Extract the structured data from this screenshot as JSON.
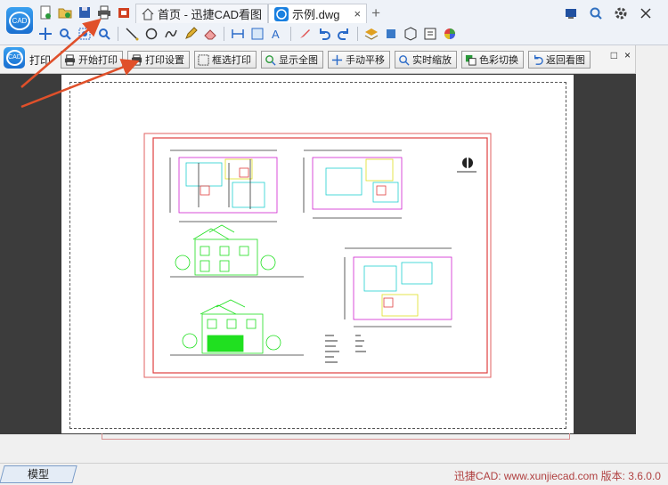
{
  "app": {
    "logo_text": "CAD"
  },
  "tabs": [
    {
      "label": "首页 - 迅捷CAD看图",
      "icon": "home-icon"
    },
    {
      "label": "示例.dwg",
      "icon": "cad-file-icon",
      "close": "×"
    }
  ],
  "new_tab": "+",
  "print_panel": {
    "title": "打印",
    "buttons": [
      {
        "label": "开始打印",
        "icon": "printer-icon"
      },
      {
        "label": "打印设置",
        "icon": "print-settings-icon"
      },
      {
        "label": "框选打印",
        "icon": "box-select-icon"
      },
      {
        "label": "显示全图",
        "icon": "zoom-extents-icon"
      },
      {
        "label": "手动平移",
        "icon": "pan-icon"
      },
      {
        "label": "实时缩放",
        "icon": "realtime-zoom-icon"
      },
      {
        "label": "色彩切换",
        "icon": "color-switch-icon"
      },
      {
        "label": "返回看图",
        "icon": "return-icon"
      }
    ],
    "win_restore": "□",
    "win_close": "×"
  },
  "status": {
    "model_tab": "模型",
    "version_text": "迅捷CAD: www.xunjiecad.com 版本: 3.6.0.0"
  },
  "colors": {
    "accent": "#1a6fd0",
    "annotation_arrow": "#e0502a"
  }
}
